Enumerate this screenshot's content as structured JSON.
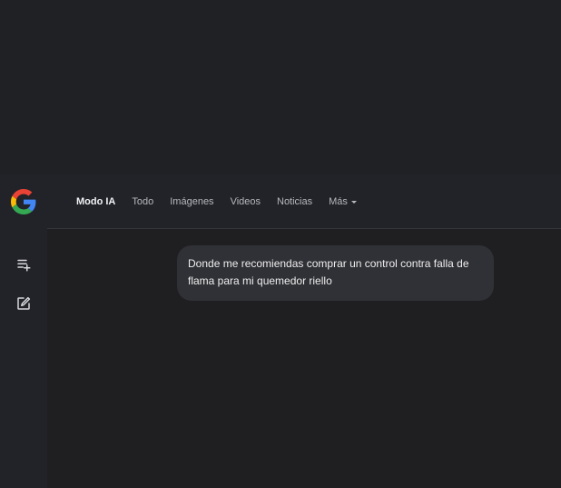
{
  "header": {
    "tabs": [
      {
        "label": "Modo IA",
        "active": true
      },
      {
        "label": "Todo",
        "active": false
      },
      {
        "label": "Imágenes",
        "active": false
      },
      {
        "label": "Videos",
        "active": false
      },
      {
        "label": "Noticias",
        "active": false
      },
      {
        "label": "Más",
        "active": false
      }
    ]
  },
  "chat": {
    "user_message": "Donde me recomiendas comprar un control contra falla de flama para mi quemedor riello"
  },
  "icons": {
    "logo": "google-logo",
    "rail_top": "new-thread-icon",
    "rail_bottom": "edit-icon"
  },
  "colors": {
    "background": "#1f1f22",
    "bubble": "#303136",
    "text": "#eeeeee"
  }
}
